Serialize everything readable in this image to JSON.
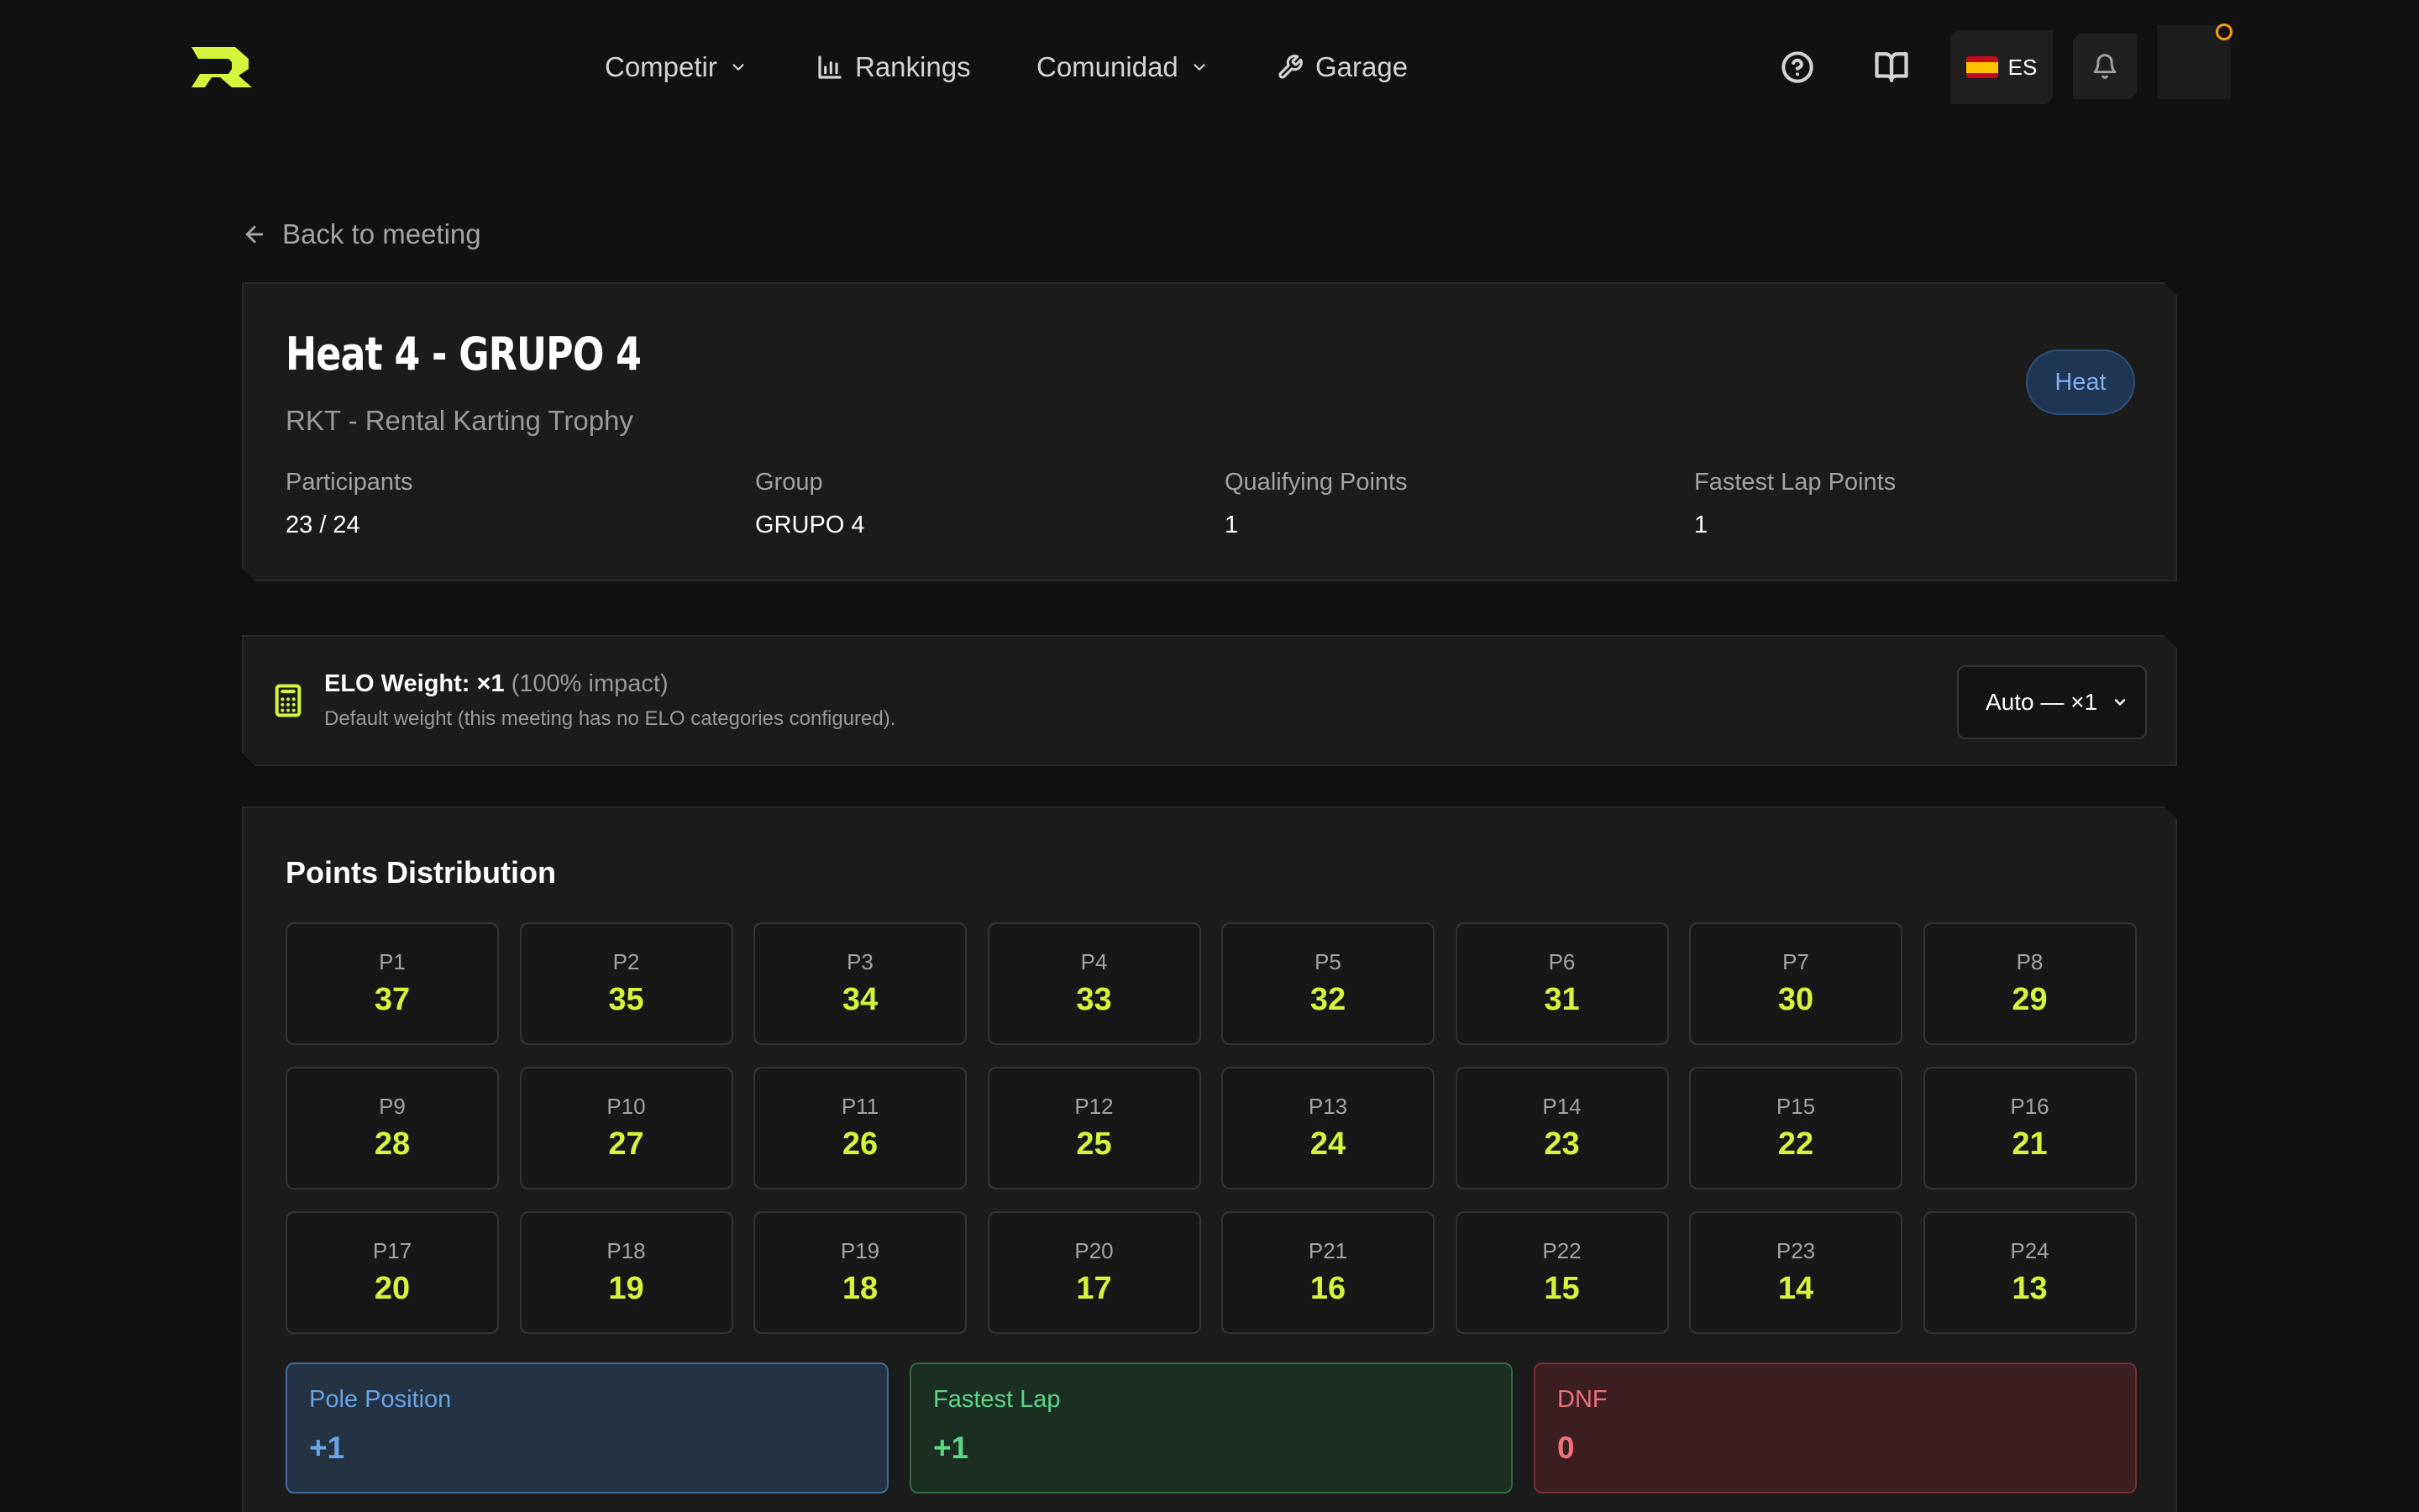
{
  "nav": {
    "items": [
      {
        "label": "Competir"
      },
      {
        "label": "Rankings"
      },
      {
        "label": "Comunidad"
      },
      {
        "label": "Garage"
      }
    ],
    "language": "ES"
  },
  "back_label": "Back to meeting",
  "heat": {
    "title": "Heat 4 - GRUPO 4",
    "subtitle": "RKT - Rental Karting Trophy",
    "badge": "Heat",
    "stats": [
      {
        "label": "Participants",
        "value": "23 / 24"
      },
      {
        "label": "Group",
        "value": "GRUPO 4"
      },
      {
        "label": "Qualifying Points",
        "value": "1"
      },
      {
        "label": "Fastest Lap Points",
        "value": "1"
      }
    ]
  },
  "elo": {
    "label": "ELO Weight: ×1",
    "impact": "(100% impact)",
    "note": "Default weight (this meeting has no ELO categories configured).",
    "select_value": "Auto — ×1"
  },
  "points": {
    "title": "Points Distribution",
    "positions": [
      {
        "pos": "P1",
        "pts": "37"
      },
      {
        "pos": "P2",
        "pts": "35"
      },
      {
        "pos": "P3",
        "pts": "34"
      },
      {
        "pos": "P4",
        "pts": "33"
      },
      {
        "pos": "P5",
        "pts": "32"
      },
      {
        "pos": "P6",
        "pts": "31"
      },
      {
        "pos": "P7",
        "pts": "30"
      },
      {
        "pos": "P8",
        "pts": "29"
      },
      {
        "pos": "P9",
        "pts": "28"
      },
      {
        "pos": "P10",
        "pts": "27"
      },
      {
        "pos": "P11",
        "pts": "26"
      },
      {
        "pos": "P12",
        "pts": "25"
      },
      {
        "pos": "P13",
        "pts": "24"
      },
      {
        "pos": "P14",
        "pts": "23"
      },
      {
        "pos": "P15",
        "pts": "22"
      },
      {
        "pos": "P16",
        "pts": "21"
      },
      {
        "pos": "P17",
        "pts": "20"
      },
      {
        "pos": "P18",
        "pts": "19"
      },
      {
        "pos": "P19",
        "pts": "18"
      },
      {
        "pos": "P20",
        "pts": "17"
      },
      {
        "pos": "P21",
        "pts": "16"
      },
      {
        "pos": "P22",
        "pts": "15"
      },
      {
        "pos": "P23",
        "pts": "14"
      },
      {
        "pos": "P24",
        "pts": "13"
      }
    ],
    "bonuses": {
      "pole": {
        "label": "Pole Position",
        "value": "+1"
      },
      "fastest": {
        "label": "Fastest Lap",
        "value": "+1"
      },
      "dnf": {
        "label": "DNF",
        "value": "0"
      }
    }
  },
  "colors": {
    "accent": "#d4f53c",
    "background": "#111111",
    "card": "#1b1b1b"
  }
}
